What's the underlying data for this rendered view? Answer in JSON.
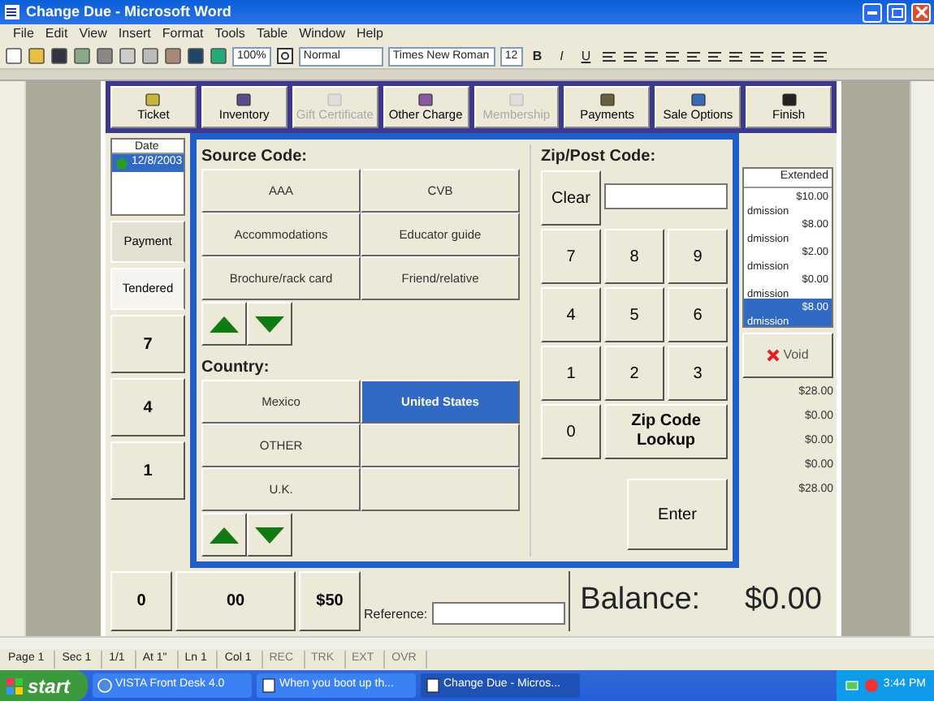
{
  "window": {
    "title": "Change Due - Microsoft Word"
  },
  "menu": [
    "File",
    "Edit",
    "View",
    "Insert",
    "Format",
    "Tools",
    "Table",
    "Window",
    "Help"
  ],
  "toolbar": {
    "zoom": "100%",
    "style": "Normal",
    "font": "Times New Roman",
    "size": "12",
    "format_buttons": [
      "B",
      "I",
      "U"
    ]
  },
  "pos_toolbar": [
    {
      "label": "Ticket",
      "disabled": false
    },
    {
      "label": "Inventory",
      "disabled": false
    },
    {
      "label": "Gift Certificate",
      "disabled": true
    },
    {
      "label": "Other Charge",
      "disabled": false
    },
    {
      "label": "Membership",
      "disabled": true
    },
    {
      "label": "Payments",
      "disabled": false
    },
    {
      "label": "Sale Options",
      "disabled": false
    },
    {
      "label": "Finish",
      "disabled": false
    }
  ],
  "transaction_list": {
    "column": "Date",
    "rows": [
      {
        "date": "12/8/2003",
        "selected": true
      }
    ]
  },
  "payment_tabs": [
    {
      "label": "Payment",
      "selected": false
    },
    {
      "label": "Tendered",
      "selected": true
    }
  ],
  "side_keys": [
    "7",
    "4",
    "1"
  ],
  "bottom_keys": [
    "0",
    "00",
    "$50"
  ],
  "reference": {
    "label": "Reference:"
  },
  "line_items": {
    "column": "Extended",
    "rows": [
      {
        "amount": "$10.00",
        "description": "dmission",
        "selected": false
      },
      {
        "amount": "$8.00",
        "description": "dmission",
        "selected": false
      },
      {
        "amount": "$2.00",
        "description": "dmission",
        "selected": false
      },
      {
        "amount": "$0.00",
        "description": "dmission",
        "selected": false
      },
      {
        "amount": "$8.00",
        "description": "dmission",
        "selected": true
      }
    ]
  },
  "void_button": "Void",
  "totals": [
    "$28.00",
    "$0.00",
    "$0.00",
    "$0.00",
    "$28.00"
  ],
  "balance": {
    "label": "Balance:",
    "value": "$0.00"
  },
  "dialog": {
    "source_code": {
      "label": "Source Code:",
      "options": [
        {
          "label": "AAA",
          "selected": false
        },
        {
          "label": "Accommodations",
          "selected": false
        },
        {
          "label": "Brochure/rack card",
          "selected": false
        },
        {
          "label": "CVB",
          "selected": false
        },
        {
          "label": "Educator guide",
          "selected": false
        },
        {
          "label": "Friend/relative",
          "selected": false
        }
      ]
    },
    "country": {
      "label": "Country:",
      "options": [
        {
          "label": "Mexico",
          "selected": false
        },
        {
          "label": "OTHER",
          "selected": false
        },
        {
          "label": "U.K.",
          "selected": false
        },
        {
          "label": "United States",
          "selected": true
        }
      ]
    },
    "zip": {
      "label": "Zip/Post Code:",
      "clear": "Clear",
      "keys": [
        "7",
        "8",
        "9",
        "4",
        "5",
        "6",
        "1",
        "2",
        "3"
      ],
      "zero": "0",
      "lookup": "Zip Code Lookup",
      "enter": "Enter"
    }
  },
  "status_bar": {
    "fields": [
      "Page 1",
      "Sec 1",
      "1/1",
      "At 1\"",
      "Ln 1",
      "Col 1"
    ],
    "indicators": [
      {
        "label": "REC",
        "active": false
      },
      {
        "label": "TRK",
        "active": false
      },
      {
        "label": "EXT",
        "active": false
      },
      {
        "label": "OVR",
        "active": false
      }
    ]
  },
  "taskbar": {
    "start": "start",
    "tasks": [
      {
        "label": "VISTA Front Desk 4.0",
        "selected": false
      },
      {
        "label": "When you boot up th...",
        "selected": false
      },
      {
        "label": "Change Due - Micros...",
        "selected": true
      }
    ],
    "clock": "3:44 PM"
  }
}
